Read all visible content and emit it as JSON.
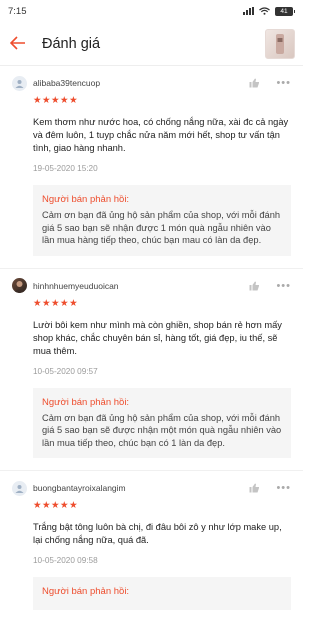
{
  "status_bar": {
    "time": "7:15",
    "battery": "41"
  },
  "header": {
    "title": "Đánh giá"
  },
  "colors": {
    "accent": "#ee4d2d"
  },
  "reviews": [
    {
      "username": "alibaba39tencuop",
      "stars": "★★★★★",
      "rating": 5,
      "text": "Kem thơm như nước hoa, có chống nắng nữa, xài đc cả ngày và đêm luôn, 1 tuyp chắc nửa năm mới hết, shop tư vấn tận tình, giao hàng nhanh.",
      "time": "19-05-2020 15:20",
      "reply_title": "Người bán phản hồi:",
      "reply_text": "Cảm ơn bạn đã ủng hộ sản phẩm của shop, với mỗi đánh giá 5 sao bạn sẽ nhận được 1 món quà ngẫu nhiên vào lần mua hàng tiếp theo, chúc bạn mau có làn da đẹp."
    },
    {
      "username": "hinhnhuemyeuduoican",
      "stars": "★★★★★",
      "rating": 5,
      "text": "Lười bôi kem như mình mà còn ghiền, shop bán rẻ hơn mấy shop khác, chắc chuyên bán sỉ, hàng tốt, giá đẹp, iu thế, sẽ mua thêm.",
      "time": "10-05-2020 09:57",
      "reply_title": "Người bán phản hồi:",
      "reply_text": "Cảm ơn bạn đã ủng hộ sản phẩm của shop, với mỗi đánh giá 5 sao bạn sẽ được nhận một món quà ngẫu nhiên vào lần mua tiếp theo, chúc bạn có 1 làn da đẹp."
    },
    {
      "username": "buongbantayroixalangim",
      "stars": "★★★★★",
      "rating": 5,
      "text": "Trắng bật tông luôn bà chị, đi đâu bôi zô y như lớp make up, lại chống nắng nữa, quá đã.",
      "time": "10-05-2020 09:58",
      "reply_title": "Người bán phản hồi:",
      "reply_text": ""
    }
  ]
}
